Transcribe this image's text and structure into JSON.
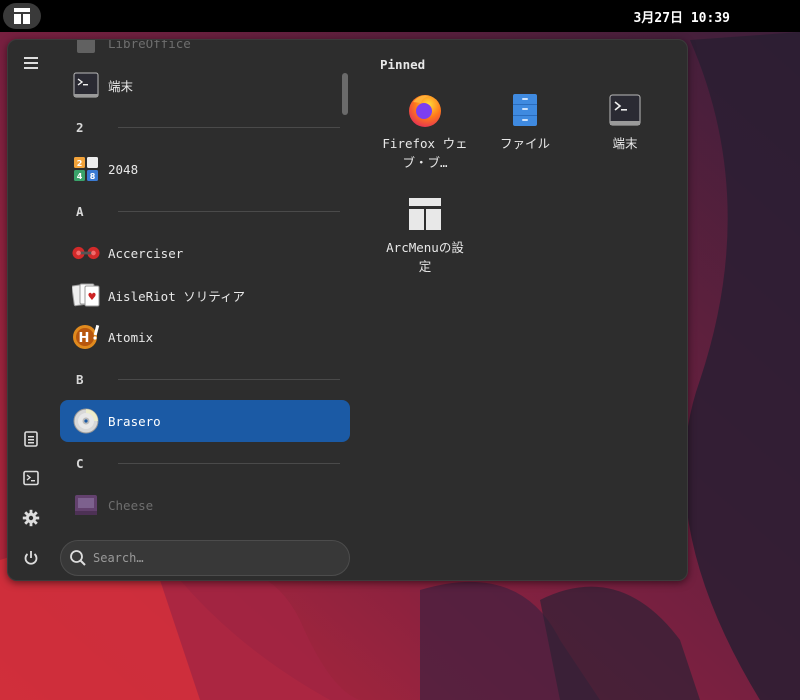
{
  "topbar": {
    "clock": "3月27日  10:39"
  },
  "sidebar": {
    "buttons": [
      {
        "name": "hamburger-menu",
        "icon": "hamburger-icon"
      },
      {
        "name": "documents",
        "icon": "document-icon"
      },
      {
        "name": "terminal",
        "icon": "terminal-icon"
      },
      {
        "name": "settings",
        "icon": "gear-icon"
      },
      {
        "name": "power",
        "icon": "power-icon"
      }
    ]
  },
  "app_list": {
    "items": [
      {
        "kind": "app",
        "label": "LibreOffice",
        "icon": "libreoffice-icon",
        "state": "faded"
      },
      {
        "kind": "app",
        "label": "端末",
        "icon": "terminal-icon"
      },
      {
        "kind": "header",
        "label": "2"
      },
      {
        "kind": "app",
        "label": "2048",
        "icon": "game-2048-icon"
      },
      {
        "kind": "header",
        "label": "A"
      },
      {
        "kind": "app",
        "label": "Accerciser",
        "icon": "accerciser-icon"
      },
      {
        "kind": "app",
        "label": "AisleRiot ソリティア",
        "icon": "cards-icon"
      },
      {
        "kind": "app",
        "label": "Atomix",
        "icon": "atomix-icon"
      },
      {
        "kind": "header",
        "label": "B"
      },
      {
        "kind": "app",
        "label": "Brasero",
        "icon": "disc-icon",
        "state": "selected"
      },
      {
        "kind": "header",
        "label": "C"
      },
      {
        "kind": "app",
        "label": "Cheese",
        "icon": "cheese-icon",
        "state": "faded"
      }
    ]
  },
  "search": {
    "placeholder": "Search…"
  },
  "pinned": {
    "title": "Pinned",
    "apps": [
      {
        "label": "Firefox ウェブ・ブ…",
        "icon": "firefox-icon"
      },
      {
        "label": "ファイル",
        "icon": "files-icon"
      },
      {
        "label": "端末",
        "icon": "terminal-icon"
      },
      {
        "label": "ArcMenuの設定",
        "icon": "arcmenu-icon"
      }
    ]
  },
  "colors": {
    "menu_bg": "#2d2d2d",
    "selected_bg": "#1b5aa5",
    "topbar_bg": "#000000"
  }
}
